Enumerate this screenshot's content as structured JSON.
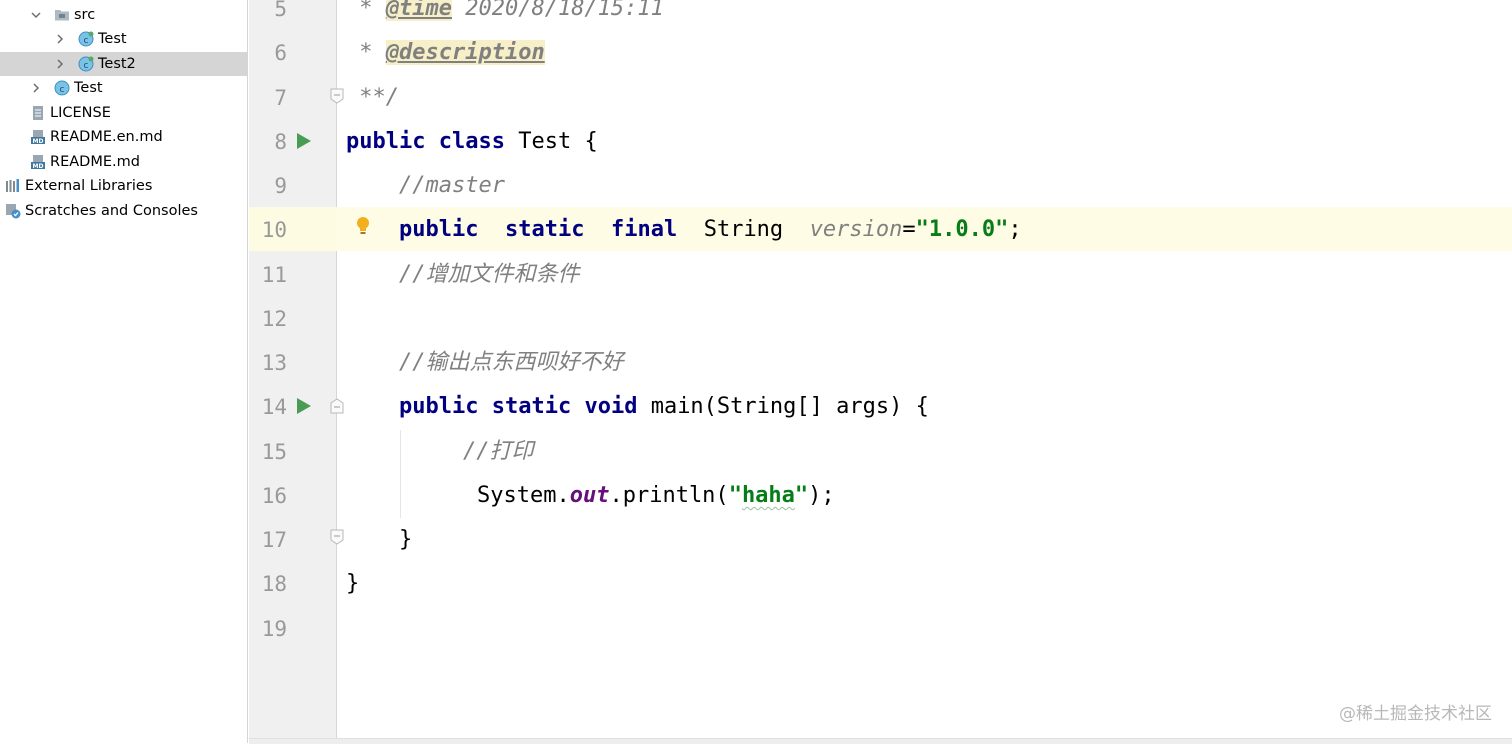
{
  "tree": {
    "src": "src",
    "test_pkg": "Test",
    "test2_pkg": "Test2",
    "test_class": "Test",
    "license": "LICENSE",
    "readme_en": "README.en.md",
    "readme": "README.md",
    "external_libraries": "External Libraries",
    "scratches": "Scratches and Consoles"
  },
  "editor": {
    "line_numbers": [
      "5",
      "6",
      "7",
      "8",
      "9",
      "10",
      "11",
      "12",
      "13",
      "14",
      "15",
      "16",
      "17",
      "18",
      "19"
    ],
    "lines": {
      "l5_prefix": " * ",
      "l5_tag": "@time",
      "l5_text": " 2020/8/18/15:11",
      "l6_prefix": " * ",
      "l6_tag": "@description",
      "l7_text": " **/",
      "l8_kw1": "public",
      "l8_kw2": "class",
      "l8_name": " Test {",
      "l9_comment": "//master",
      "l10_kw1": "public",
      "l10_kw2": "static",
      "l10_kw3": "final",
      "l10_type": "String",
      "l10_var": "version",
      "l10_eq": "=",
      "l10_str": "\"1.0.0\"",
      "l10_end": ";",
      "l11_comment": "//增加文件和条件",
      "l13_comment": "//输出点东西呗好不好",
      "l14_kw1": "public",
      "l14_kw2": "static",
      "l14_kw3": "void",
      "l14_rest": " main(String[] args) {",
      "l15_comment": "//打印",
      "l16_a": "System.",
      "l16_field": "out",
      "l16_b": ".println(",
      "l16_q1": "\"",
      "l16_str": "haha",
      "l16_q2": "\"",
      "l16_end": ");",
      "l17_text": "}",
      "l18_text": "}"
    }
  },
  "watermark": "@稀土掘金技术社区",
  "colors": {
    "keyword": "#000080",
    "comment": "#808080",
    "string": "#067d17",
    "field": "#660e7a",
    "run_arrow": "#499c54",
    "current_line": "#fefce4",
    "selection": "#d5d5d5"
  },
  "icons": {
    "class": "class-icon",
    "run": "run-icon",
    "fold": "fold-icon",
    "bulb": "lightbulb-icon",
    "folder": "folder-icon",
    "markdown": "markdown-file-icon",
    "text": "text-file-icon",
    "libraries": "libraries-icon",
    "scratches": "scratches-icon"
  }
}
